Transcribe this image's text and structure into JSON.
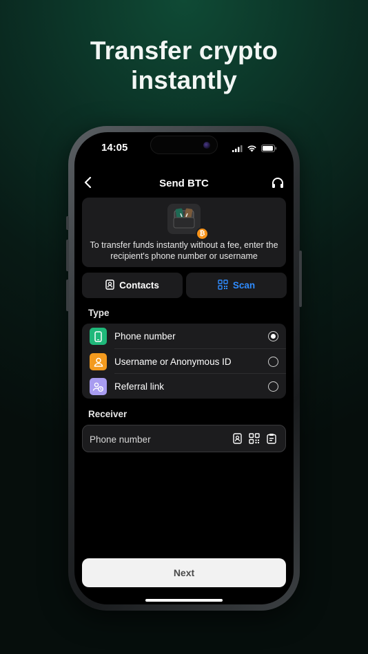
{
  "promo": {
    "headline_line1": "Transfer crypto",
    "headline_line2": "instantly"
  },
  "status_bar": {
    "time": "14:05"
  },
  "nav": {
    "title": "Send BTC",
    "back_icon": "chevron-left-icon",
    "support_icon": "headset-icon"
  },
  "info": {
    "text": "To transfer funds instantly without a fee, enter the recipient's phone number or username",
    "badge": "₿"
  },
  "actions": {
    "contacts_label": "Contacts",
    "scan_label": "Scan"
  },
  "type_section": {
    "label": "Type",
    "options": [
      {
        "label": "Phone number",
        "selected": true,
        "icon": "phone-icon",
        "color": "#1fb87a"
      },
      {
        "label": "Username or Anonymous ID",
        "selected": false,
        "icon": "user-icon",
        "color": "#f39a1e"
      },
      {
        "label": "Referral link",
        "selected": false,
        "icon": "referral-icon",
        "color": "#a89cf0"
      }
    ]
  },
  "receiver": {
    "label": "Receiver",
    "placeholder": "Phone number",
    "value": ""
  },
  "next_label": "Next",
  "colors": {
    "accent_blue": "#2f8cff",
    "card_bg": "#1c1c1e",
    "btc_orange": "#f7931a"
  }
}
